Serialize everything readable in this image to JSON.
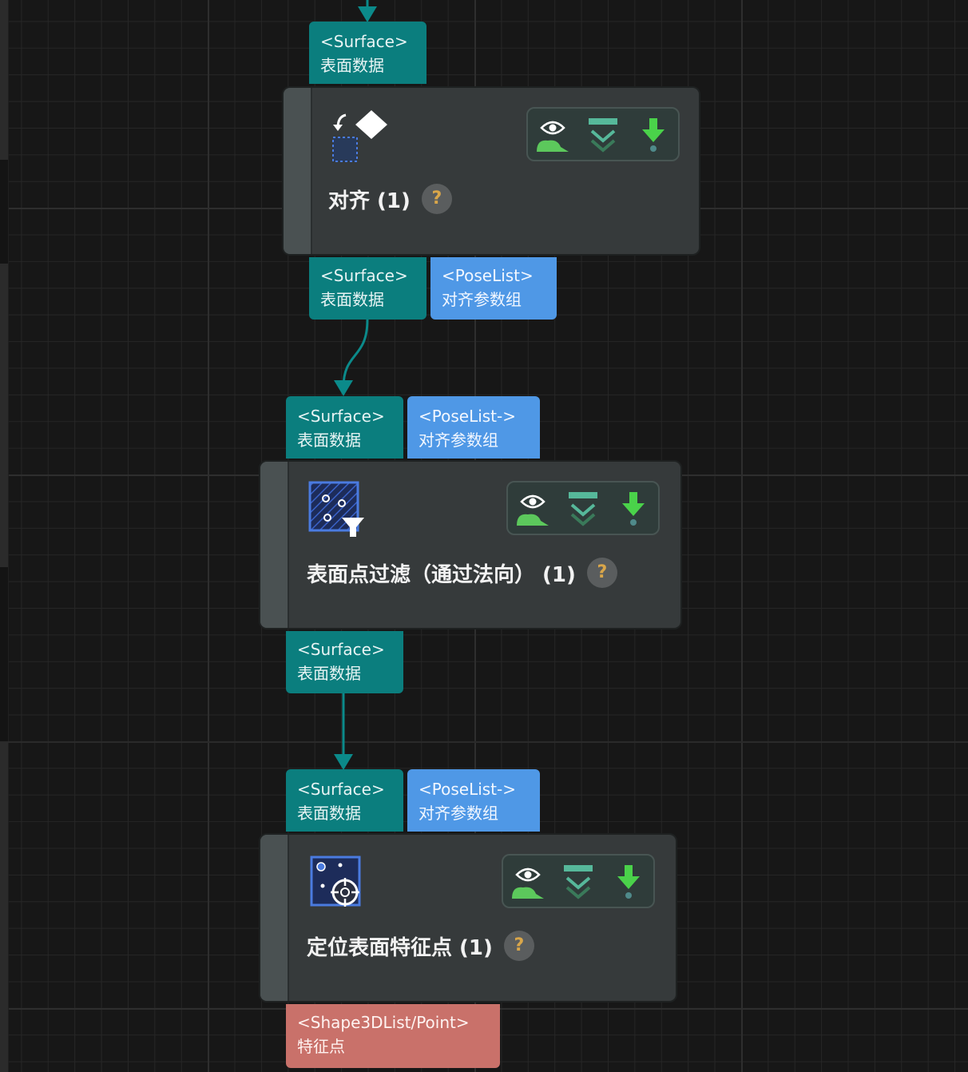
{
  "ports": {
    "top_in_surface": {
      "type": "<Surface>",
      "label": "表面数据"
    },
    "align_out_surface": {
      "type": "<Surface>",
      "label": "表面数据"
    },
    "align_out_pose": {
      "type": "<PoseList>",
      "label": "对齐参数组"
    },
    "filter_in_surface": {
      "type": "<Surface>",
      "label": "表面数据"
    },
    "filter_in_pose": {
      "type": "<PoseList->",
      "label": "对齐参数组"
    },
    "filter_out_surface": {
      "type": "<Surface>",
      "label": "表面数据"
    },
    "locate_in_surface": {
      "type": "<Surface>",
      "label": "表面数据"
    },
    "locate_in_pose": {
      "type": "<PoseList->",
      "label": "对齐参数组"
    },
    "locate_out_shape": {
      "type": "<Shape3DList/Point>",
      "label": "特征点"
    }
  },
  "nodes": [
    {
      "title": "对齐 (1)",
      "help": "?"
    },
    {
      "title": "表面点过滤（通过法向） (1)",
      "help": "?"
    },
    {
      "title": "定位表面特征点 (1)",
      "help": "?"
    }
  ],
  "colors": {
    "surface": "#0b7e7e",
    "pose": "#4f98e6",
    "shape": "#c9716a",
    "node_bg": "#363a3b",
    "link": "#0b8a8a"
  }
}
